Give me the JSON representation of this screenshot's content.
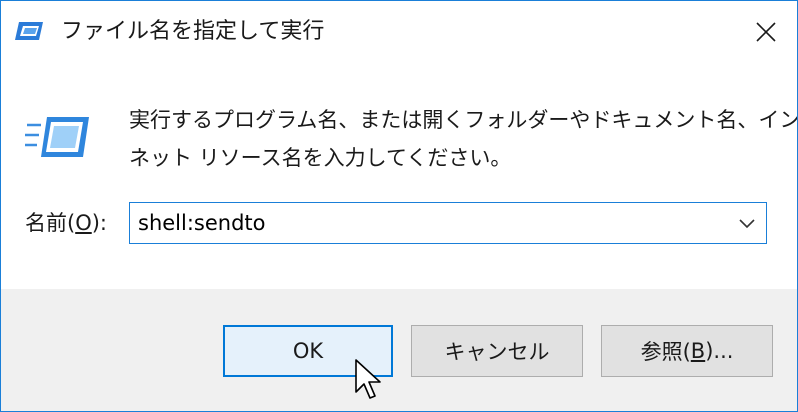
{
  "window": {
    "title": "ファイル名を指定して実行",
    "title_icon": "run-dialog-icon",
    "close_icon": "close-icon",
    "accent_color": "#1a7fd8"
  },
  "content": {
    "icon": "run-icon",
    "description_line1": "実行するプログラム名、または開くフォルダーやドキュメント名、インター",
    "description_line2": "ネット リソース名を入力してください。",
    "open_label_prefix": "名前(",
    "open_label_key": "O",
    "open_label_suffix": "):",
    "open_value": "shell:sendto",
    "dropdown_icon": "chevron-down-icon"
  },
  "buttons": {
    "ok_label": "OK",
    "cancel_label": "キャンセル",
    "browse_prefix": "参照(",
    "browse_key": "B",
    "browse_suffix": ")..."
  },
  "footer_color": "#f0f0f0"
}
